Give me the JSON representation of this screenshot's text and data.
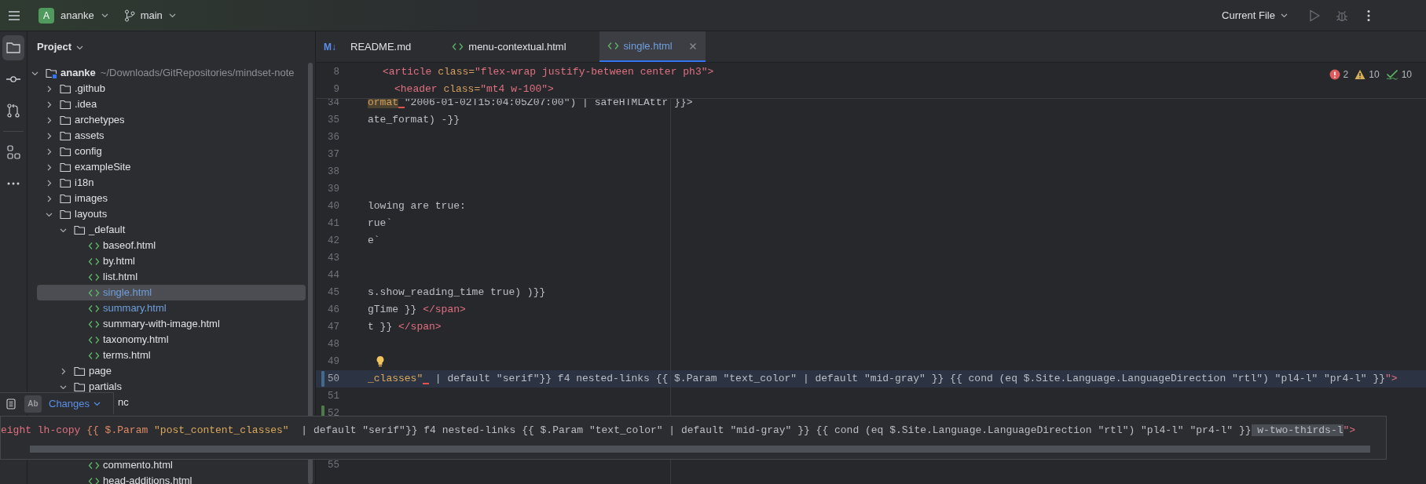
{
  "toolbar": {
    "project": {
      "avatar": "A",
      "name": "ananke"
    },
    "branch": "main",
    "run_config": "Current File"
  },
  "tool_strip": [
    {
      "kind": "project",
      "selected": true
    },
    {
      "kind": "commit",
      "selected": false
    },
    {
      "kind": "pull-requests",
      "selected": false
    },
    {
      "kind": "structure",
      "selected": false
    },
    {
      "kind": "more",
      "selected": false
    }
  ],
  "project_panel": {
    "title": "Project",
    "tree": [
      {
        "name": "ananke",
        "path": "~/Downloads/GitRepositories/mindset-note",
        "kind": "module",
        "expanded": true,
        "selected": false,
        "children": [
          {
            "name": ".github",
            "kind": "folder",
            "expanded": false,
            "selected": false
          },
          {
            "name": ".idea",
            "kind": "folder",
            "expanded": false,
            "selected": false
          },
          {
            "name": "archetypes",
            "kind": "folder",
            "expanded": false,
            "selected": false
          },
          {
            "name": "assets",
            "kind": "folder",
            "expanded": false,
            "selected": false
          },
          {
            "name": "config",
            "kind": "folder",
            "expanded": false,
            "selected": false
          },
          {
            "name": "exampleSite",
            "kind": "folder",
            "expanded": false,
            "selected": false
          },
          {
            "name": "i18n",
            "kind": "folder",
            "expanded": false,
            "selected": false
          },
          {
            "name": "images",
            "kind": "folder",
            "expanded": false,
            "selected": false
          },
          {
            "name": "layouts",
            "kind": "folder",
            "expanded": true,
            "selected": false,
            "children": [
              {
                "name": "_default",
                "kind": "folder",
                "expanded": true,
                "selected": false,
                "children": [
                  {
                    "name": "baseof.html",
                    "kind": "file",
                    "modified": false,
                    "selected": false
                  },
                  {
                    "name": "by.html",
                    "kind": "file",
                    "modified": false,
                    "selected": false
                  },
                  {
                    "name": "list.html",
                    "kind": "file",
                    "modified": false,
                    "selected": false
                  },
                  {
                    "name": "single.html",
                    "kind": "file",
                    "modified": true,
                    "selected": true
                  },
                  {
                    "name": "summary.html",
                    "kind": "file",
                    "modified": true,
                    "selected": false
                  },
                  {
                    "name": "summary-with-image.html",
                    "kind": "file",
                    "modified": false,
                    "selected": false
                  },
                  {
                    "name": "taxonomy.html",
                    "kind": "file",
                    "modified": false,
                    "selected": false
                  },
                  {
                    "name": "terms.html",
                    "kind": "file",
                    "modified": false,
                    "selected": false
                  }
                ]
              },
              {
                "name": "page",
                "kind": "folder",
                "expanded": false,
                "selected": false
              },
              {
                "name": "partials",
                "kind": "folder",
                "expanded": true,
                "selected": false,
                "children": [
                  {
                    "name": "nc",
                    "kind": "fragment",
                    "selected": false
                  },
                  {
                    "name": "commento.html",
                    "kind": "file",
                    "modified": false,
                    "selected": false
                  },
                  {
                    "name": "head-additions.html",
                    "kind": "file",
                    "modified": false,
                    "selected": false
                  }
                ]
              }
            ]
          }
        ]
      }
    ]
  },
  "tabs": [
    {
      "label": "README.md",
      "kind": "markdown",
      "icon_text": "M↓",
      "selected": false,
      "modified": false
    },
    {
      "label": "menu-contextual.html",
      "kind": "html",
      "selected": false,
      "modified": false
    },
    {
      "label": "single.html",
      "kind": "html",
      "selected": true,
      "modified": true
    }
  ],
  "inspections": {
    "errors": "2",
    "warnings": "10",
    "weak_warnings": "10"
  },
  "sticky_lines": [
    {
      "number": "8",
      "tokens": [
        {
          "kind": "tag",
          "text": "<article"
        },
        {
          "kind": "attr",
          "text": " class="
        },
        {
          "kind": "string",
          "text": "\"flex-wrap justify-between center ph3\">"
        }
      ],
      "children": [
        {
          "number": "9",
          "tokens": [
            {
              "kind": "tag",
              "text": "<header"
            },
            {
              "kind": "attr",
              "text": " class="
            },
            {
              "kind": "string",
              "text": "\"mt4 w-100\">"
            }
          ]
        }
      ]
    }
  ],
  "lines": [
    {
      "number": "34",
      "current": false,
      "bulb": false,
      "tokens": [
        {
          "kind": "highlight",
          "text": "ormat",
          "error_after": true
        },
        {
          "kind": "plain",
          "text": "\"2006-01-02T15:04:05Z07:00\") | safeHTMLAttr }}>"
        }
      ]
    },
    {
      "number": "35",
      "current": false,
      "bulb": false,
      "tokens": [
        {
          "kind": "plain",
          "text": "ate_format) -}}"
        }
      ]
    },
    {
      "number": "36",
      "current": false,
      "bulb": false
    },
    {
      "number": "37",
      "current": false,
      "bulb": false
    },
    {
      "number": "38",
      "current": false,
      "bulb": false
    },
    {
      "number": "39",
      "current": false,
      "bulb": false
    },
    {
      "number": "40",
      "current": false,
      "bulb": false,
      "tokens": [
        {
          "kind": "plain",
          "text": "lowing are true:"
        }
      ]
    },
    {
      "number": "41",
      "current": false,
      "bulb": false,
      "tokens": [
        {
          "kind": "plain",
          "text": "rue`"
        }
      ]
    },
    {
      "number": "42",
      "current": false,
      "bulb": false,
      "tokens": [
        {
          "kind": "plain",
          "text": "e`"
        }
      ]
    },
    {
      "number": "43",
      "current": false,
      "bulb": false
    },
    {
      "number": "44",
      "current": false,
      "bulb": false
    },
    {
      "number": "45",
      "current": false,
      "bulb": false,
      "tokens": [
        {
          "kind": "plain",
          "text": "s.show_reading_time true) )}}"
        }
      ]
    },
    {
      "number": "46",
      "current": false,
      "bulb": false,
      "tokens": [
        {
          "kind": "plain",
          "text": "gTime }} "
        },
        {
          "kind": "tag",
          "text": "</span>"
        }
      ]
    },
    {
      "number": "47",
      "current": false,
      "bulb": false,
      "tokens": [
        {
          "kind": "plain",
          "text": "t }} "
        },
        {
          "kind": "tag",
          "text": "</span>"
        }
      ]
    },
    {
      "number": "48",
      "current": false,
      "bulb": false
    },
    {
      "number": "49",
      "current": false,
      "bulb": true
    },
    {
      "number": "50",
      "modified": true,
      "current": true,
      "bulb": false,
      "tokens": [
        {
          "kind": "key",
          "text": "_classes\"",
          "error_after": true
        },
        {
          "kind": "plain",
          "text": " | default \"serif\"}} f4 nested-links {{ $.Param \"text_color\" | default \"mid-gray\" }} {{ cond (eq $.Site.Language.LanguageDirection \"rtl\") \"pl4-l\" \"pr4-l\" }}"
        },
        {
          "kind": "string",
          "text": "\">"
        }
      ]
    },
    {
      "number": "51",
      "current": false,
      "bulb": false
    },
    {
      "number": "52",
      "added": true,
      "current": false,
      "bulb": false
    },
    {
      "number": "55",
      "current": false,
      "bulb": false
    }
  ],
  "changes_widget": {
    "toggle": "Ab",
    "label": "Changes"
  },
  "line_preview": {
    "tokens": [
      {
        "kind": "string",
        "text": "eight lh-copy "
      },
      {
        "kind": "template",
        "text": "{{ $.Param "
      },
      {
        "kind": "key",
        "text": "\"post_content_classes\""
      },
      {
        "kind": "plain",
        "text": "  | default \"serif\"}} f4 nested-links {{ $.Param \"text_color\" | default \"mid-gray\" }} {{ cond (eq $.Site.Language.LanguageDirection \"rtl\") \"pl4-l\" \"pr4-l\" }}"
      },
      {
        "kind": "selection",
        "text": " w-two-thirds-l"
      },
      {
        "kind": "string",
        "text": "\">"
      }
    ]
  }
}
